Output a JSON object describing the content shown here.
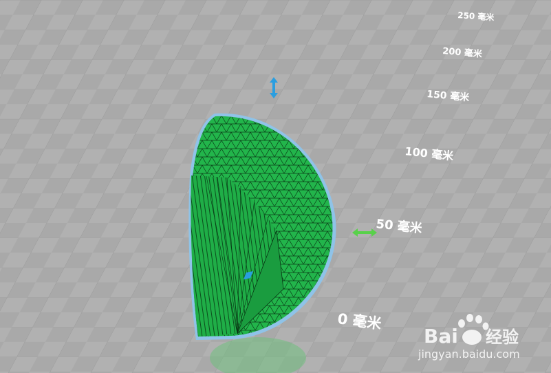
{
  "viewport": {
    "background": "#a7a7a7",
    "grid_color": "#8f8f8f",
    "model_color": "#21b34a",
    "model_outline": "#8fc3e8"
  },
  "ruler": {
    "labels": [
      "250 毫米",
      "200 毫米",
      "150 毫米",
      "100 毫米",
      "50 毫米",
      "0 毫米"
    ]
  },
  "gizmo": {
    "vertical_arrow": "move-vertical-icon",
    "horizontal_arrow": "move-horizontal-icon",
    "rotate_handle": "rotate-icon"
  },
  "watermark": {
    "brand": "Bai",
    "brand_suffix": "经验",
    "url": "jingyan.baidu.com"
  }
}
